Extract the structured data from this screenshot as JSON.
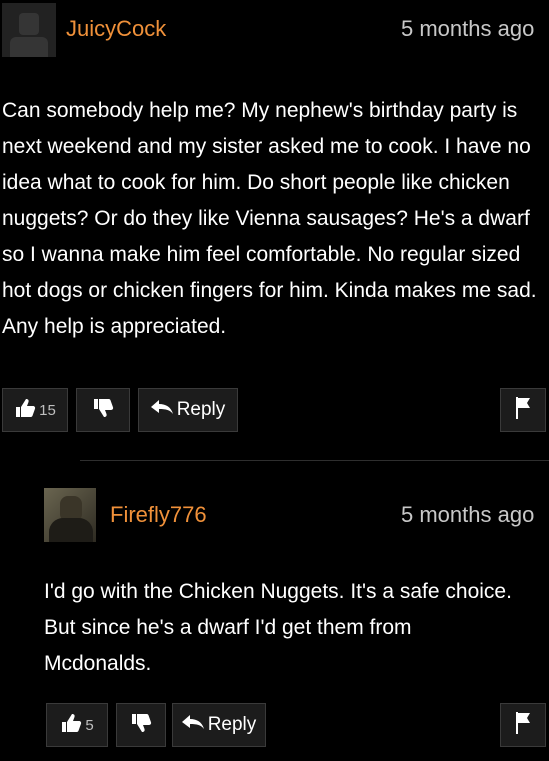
{
  "comments": [
    {
      "username": "JuicyCock",
      "time": "5 months ago",
      "text": "Can somebody help me? My nephew's birthday party is next weekend and my sister asked me to cook. I have no idea what to cook for him. Do short people like chicken nuggets? Or do they like Vienna sausages? He's a dwarf so I wanna make him feel comfortable. No regular sized hot dogs or chicken fingers for him. Kinda makes me sad. Any help is appreciated.",
      "upvotes": "15",
      "reply_label": "Reply"
    },
    {
      "username": "Firefly776",
      "time": "5 months ago",
      "text": "I'd go with the Chicken Nuggets. It's a safe choice. But since he's a dwarf I'd get them from Mcdonalds.",
      "upvotes": "5",
      "reply_label": "Reply"
    }
  ],
  "colors": {
    "background": "#000000",
    "username": "#f0913a",
    "timestamp": "#c8c8c8",
    "button_bg": "#1c1c1c"
  },
  "icons": [
    "thumbs-up-icon",
    "thumbs-down-icon",
    "reply-arrow-icon",
    "flag-icon",
    "avatar"
  ]
}
